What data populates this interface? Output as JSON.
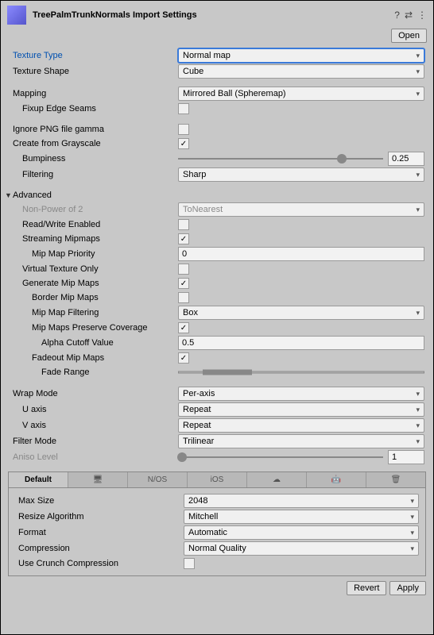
{
  "header": {
    "title": "TreePalmTrunkNormals Import Settings",
    "open": "Open"
  },
  "fields": {
    "textureType": {
      "label": "Texture Type",
      "value": "Normal map"
    },
    "textureShape": {
      "label": "Texture Shape",
      "value": "Cube"
    },
    "mapping": {
      "label": "Mapping",
      "value": "Mirrored Ball (Spheremap)"
    },
    "fixupEdge": {
      "label": "Fixup Edge Seams",
      "checked": false
    },
    "ignorePng": {
      "label": "Ignore PNG file gamma",
      "checked": false
    },
    "createGray": {
      "label": "Create from Grayscale",
      "checked": true
    },
    "bumpiness": {
      "label": "Bumpiness",
      "value": "0.25"
    },
    "filtering": {
      "label": "Filtering",
      "value": "Sharp"
    }
  },
  "advanced": {
    "title": "Advanced",
    "nonPow2": {
      "label": "Non-Power of 2",
      "value": "ToNearest"
    },
    "readWrite": {
      "label": "Read/Write Enabled",
      "checked": false
    },
    "streamMip": {
      "label": "Streaming Mipmaps",
      "checked": true
    },
    "mipPriority": {
      "label": "Mip Map Priority",
      "value": "0"
    },
    "virtTex": {
      "label": "Virtual Texture Only",
      "checked": false
    },
    "genMip": {
      "label": "Generate Mip Maps",
      "checked": true
    },
    "borderMip": {
      "label": "Border Mip Maps",
      "checked": false
    },
    "mipFilter": {
      "label": "Mip Map Filtering",
      "value": "Box"
    },
    "mipCov": {
      "label": "Mip Maps Preserve Coverage",
      "checked": true
    },
    "alphaCutoff": {
      "label": "Alpha Cutoff Value",
      "value": "0.5"
    },
    "fadeMip": {
      "label": "Fadeout Mip Maps",
      "checked": true
    },
    "fadeRange": {
      "label": "Fade Range"
    }
  },
  "wrap": {
    "wrapMode": {
      "label": "Wrap Mode",
      "value": "Per-axis"
    },
    "uAxis": {
      "label": "U axis",
      "value": "Repeat"
    },
    "vAxis": {
      "label": "V axis",
      "value": "Repeat"
    },
    "filterMode": {
      "label": "Filter Mode",
      "value": "Trilinear"
    },
    "aniso": {
      "label": "Aniso Level",
      "value": "1"
    }
  },
  "platform": {
    "tabs": [
      "Default",
      "🖥",
      "N/OS",
      "iOS",
      "☁",
      "🤖",
      "🗑"
    ],
    "maxSize": {
      "label": "Max Size",
      "value": "2048"
    },
    "resize": {
      "label": "Resize Algorithm",
      "value": "Mitchell"
    },
    "format": {
      "label": "Format",
      "value": "Automatic"
    },
    "compression": {
      "label": "Compression",
      "value": "Normal Quality"
    },
    "crunch": {
      "label": "Use Crunch Compression",
      "checked": false
    }
  },
  "footer": {
    "revert": "Revert",
    "apply": "Apply"
  }
}
